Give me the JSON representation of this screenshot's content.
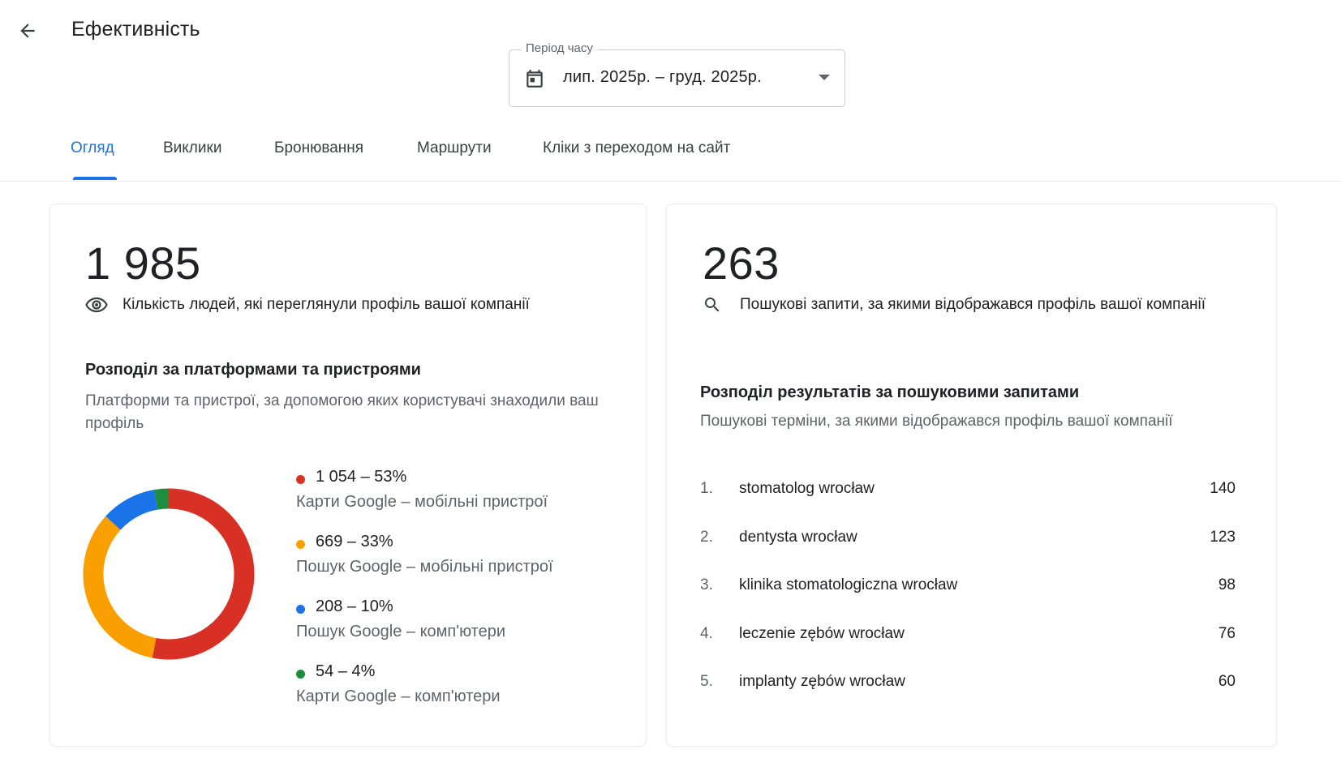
{
  "header": {
    "title": "Ефективність",
    "back_icon": "arrow-back-icon"
  },
  "period": {
    "label": "Період часу",
    "value": "лип. 2025р. – груд. 2025р.",
    "icon": "calendar-icon"
  },
  "tabs": [
    {
      "label": "Огляд",
      "active": true
    },
    {
      "label": "Виклики",
      "active": false
    },
    {
      "label": "Бронювання",
      "active": false
    },
    {
      "label": "Маршрути",
      "active": false
    },
    {
      "label": "Кліки з переходом на сайт",
      "active": false
    }
  ],
  "colors": {
    "accent": "#1a73e8",
    "red": "#d93025",
    "orange": "#f9a000",
    "blue": "#1a73e8",
    "green": "#1e8e3e"
  },
  "profile_views": {
    "value": "1 985",
    "label": "Кількість людей, які переглянули профіль вашої компанії",
    "icon": "eye-icon",
    "breakdown": {
      "title": "Розподіл за платформами та пристроями",
      "subtitle": "Платформи та пристрої, за допомогою яких користувачі знаходили ваш профіль",
      "items": [
        {
          "value": "1 054 – 53%",
          "label": "Карти Google – мобільні пристрої",
          "count": 1054,
          "color": "#d93025"
        },
        {
          "value": "669 – 33%",
          "label": "Пошук Google – мобільні пристрої",
          "count": 669,
          "color": "#f9a000"
        },
        {
          "value": "208 – 10%",
          "label": "Пошук Google – комп'ютери",
          "count": 208,
          "color": "#1a73e8"
        },
        {
          "value": "54 – 4%",
          "label": "Карти Google – комп'ютери",
          "count": 54,
          "color": "#1e8e3e"
        }
      ]
    }
  },
  "searches": {
    "value": "263",
    "label": "Пошукові запити, за якими відображався профіль вашої компанії",
    "icon": "search-icon",
    "breakdown": {
      "title": "Розподіл результатів за пошуковими запитами",
      "subtitle": "Пошукові терміни, за якими відображався профіль вашої компанії",
      "items": [
        {
          "rank": "1.",
          "term": "stomatolog wrocław",
          "count": "140"
        },
        {
          "rank": "2.",
          "term": "dentysta wrocław",
          "count": "123"
        },
        {
          "rank": "3.",
          "term": "klinika stomatologiczna wrocław",
          "count": "98"
        },
        {
          "rank": "4.",
          "term": "leczenie zębów wrocław",
          "count": "76"
        },
        {
          "rank": "5.",
          "term": "implanty zębów wrocław",
          "count": "60"
        }
      ]
    }
  }
}
